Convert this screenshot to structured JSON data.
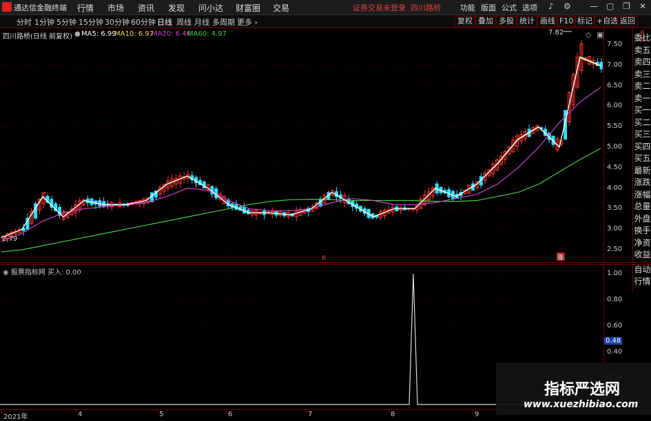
{
  "titlebar": {
    "app_name": "通达信金融终端",
    "menus": [
      "行情",
      "市场",
      "资讯",
      "发现",
      "问小达",
      "财富圈",
      "交易"
    ],
    "notice": "证券交易未登录",
    "stock_name": "四川路桥",
    "right_menus": [
      "功能",
      "版面",
      "公式",
      "选项"
    ]
  },
  "toolbar": {
    "periods": [
      "分时",
      "1分钟",
      "5分钟",
      "15分钟",
      "30分钟",
      "60分钟",
      "日线",
      "周线",
      "月线",
      "多周期",
      "更多"
    ],
    "active_period": "日线",
    "right_buttons": [
      "复权",
      "叠加",
      "多股",
      "统计",
      "画线",
      "F10",
      "标记",
      "+自选",
      "返回"
    ]
  },
  "chart_header": {
    "title": "四川路桥(日线 前复权)",
    "ma5": "MA5: 6.99",
    "ma10": "MA10: 6.97",
    "ma20": "MA20: 6.46",
    "ma60": "MA60: 4.97"
  },
  "colors": {
    "up": "#ff3333",
    "down": "#33ddff",
    "ma5": "#ffffff",
    "ma10": "#eedd66",
    "ma20": "#cc44cc",
    "ma60": "#44cc44",
    "grid": "#7a0000"
  },
  "sidetabs": [
    "委比",
    "卖五",
    "卖四",
    "卖三",
    "卖二",
    "卖一",
    "买一",
    "买二",
    "买三",
    "买四",
    "买五",
    "最新",
    "涨跌",
    "涨幅",
    "总量",
    "外盘",
    "换手",
    "净资",
    "收益"
  ],
  "sidetabs2": [
    "自动",
    "行情"
  ],
  "sidetab_top": [
    "R",
    "融"
  ],
  "chart_data": {
    "type": "candlestick",
    "price_axis": [
      "7.50",
      "7.00",
      "6.50",
      "6.00",
      "5.50",
      "5.00",
      "4.50",
      "4.00",
      "3.50",
      "3.00",
      "2.50"
    ],
    "ylim": [
      2.2,
      7.9
    ],
    "high_label": "7.82",
    "low_label": "2.79",
    "ma60": [
      2.45,
      2.5,
      2.6,
      2.7,
      2.8,
      2.9,
      3.0,
      3.1,
      3.2,
      3.3,
      3.4,
      3.5,
      3.6,
      3.68,
      3.72,
      3.73,
      3.72,
      3.7,
      3.7,
      3.7,
      3.7,
      3.68,
      3.68,
      3.7,
      3.8,
      3.9,
      4.1,
      4.4,
      4.7,
      4.97
    ],
    "ma20": [
      2.7,
      2.9,
      3.2,
      3.4,
      3.5,
      3.55,
      3.6,
      3.65,
      3.8,
      4.0,
      3.95,
      3.7,
      3.5,
      3.45,
      3.45,
      3.5,
      3.65,
      3.75,
      3.7,
      3.6,
      3.6,
      3.65,
      3.75,
      3.85,
      4.1,
      4.5,
      5.0,
      5.6,
      6.1,
      6.46
    ],
    "ma5": [
      2.8,
      3.0,
      3.8,
      3.3,
      3.7,
      3.6,
      3.6,
      3.7,
      4.1,
      4.3,
      4.0,
      3.6,
      3.4,
      3.4,
      3.35,
      3.5,
      3.9,
      3.6,
      3.3,
      3.5,
      3.5,
      4.0,
      3.8,
      4.1,
      4.6,
      5.2,
      5.5,
      5.0,
      7.2,
      6.99
    ],
    "signal_axis": [
      "1.00",
      "0.80",
      "0.60",
      "0.48",
      "0.40",
      "0.20"
    ],
    "signal_current": "0.48",
    "signal_spike_month": "8",
    "x_axis": [
      "2021年",
      "4",
      "5",
      "6",
      "7",
      "8",
      "9"
    ],
    "markers": [
      "B",
      "涨"
    ]
  },
  "subchart": {
    "title": "股票指标网",
    "buy_label": "买入: 0.00"
  },
  "watermark": {
    "line1": "指标严选网",
    "line2": "www.xuezhibiao.com"
  }
}
